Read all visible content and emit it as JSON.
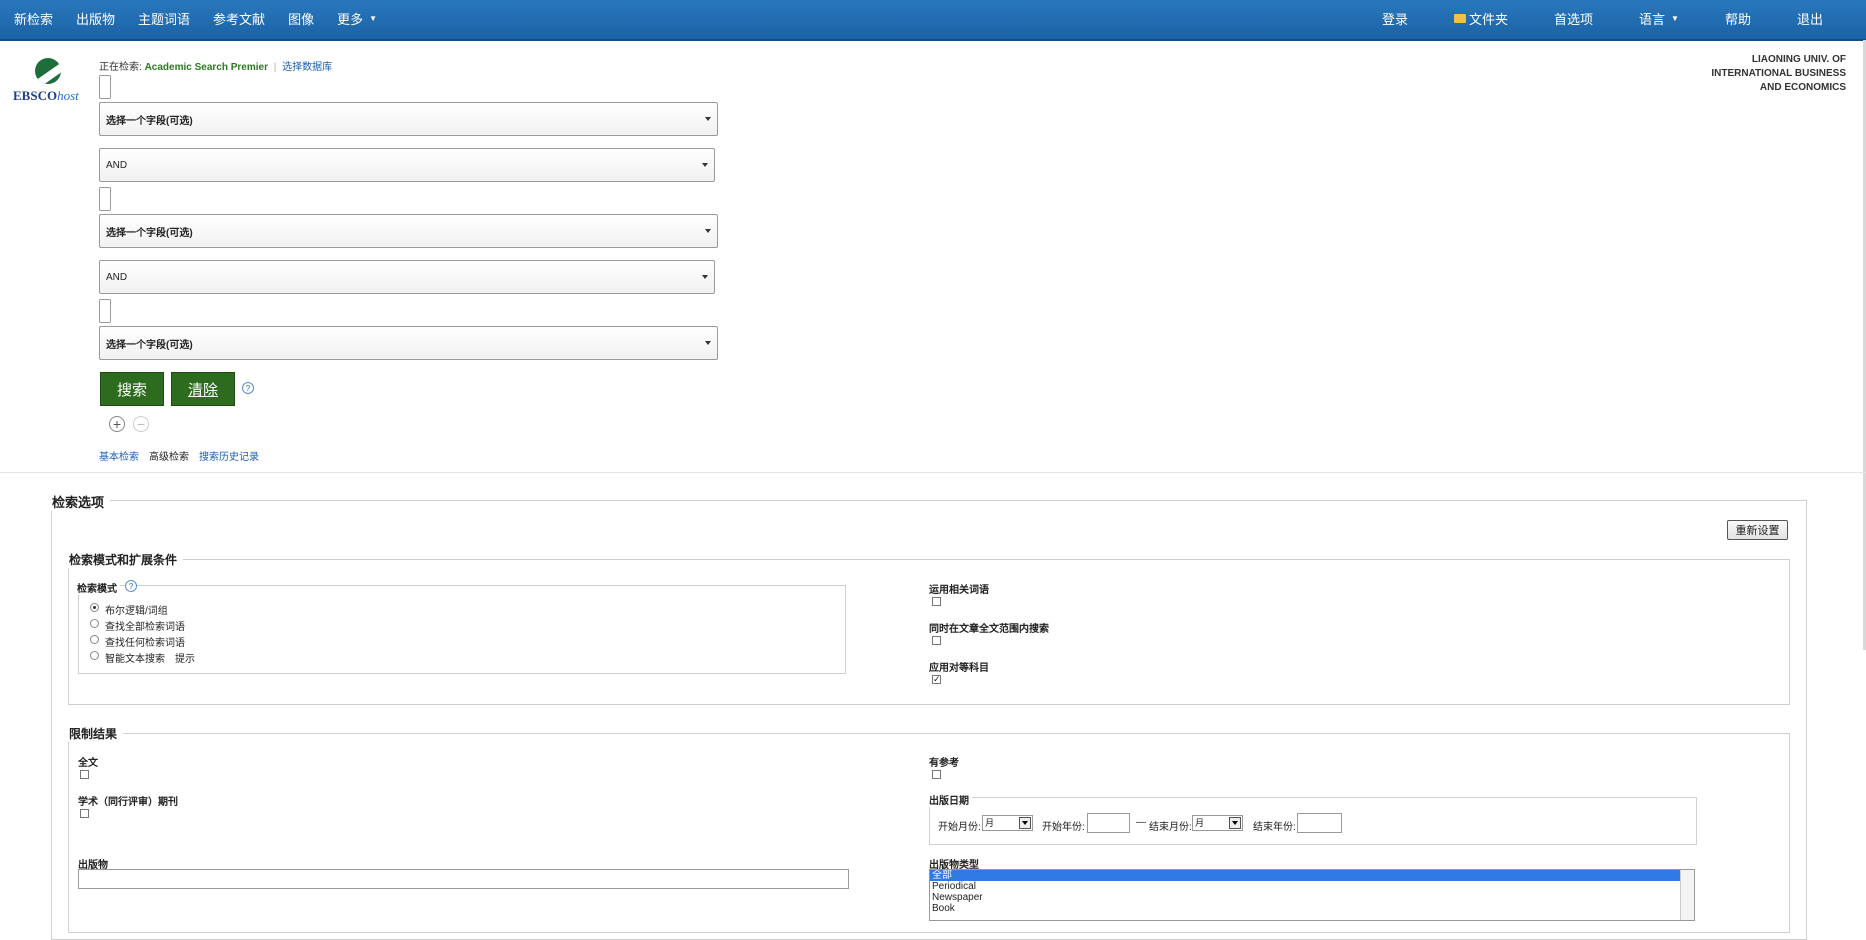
{
  "nav": {
    "left": [
      "新检索",
      "出版物",
      "主题词语",
      "参考文献",
      "图像",
      "更多"
    ],
    "right": [
      "登录",
      "文件夹",
      "首选项",
      "语言",
      "帮助",
      "退出"
    ]
  },
  "logo": {
    "brand": "EBSCO",
    "suffix": "host"
  },
  "header": {
    "searching_label": "正在检索:",
    "database": "Academic Search Premier",
    "separator": "|",
    "choose_db": "选择数据库"
  },
  "institution": [
    "LIAONING UNIV. OF",
    "INTERNATIONAL BUSINESS",
    "AND ECONOMICS"
  ],
  "search": {
    "field_placeholder": "选择一个字段(可选)",
    "bool1": "AND",
    "bool2": "AND",
    "search_btn": "搜索",
    "clear_btn": "清除",
    "help": "?",
    "plus": "+",
    "minus": "−"
  },
  "links": {
    "basic": "基本检索",
    "advanced": "高级检索",
    "history": "搜索历史记录"
  },
  "options": {
    "title": "检索选项",
    "reset": "重新设置",
    "modes": {
      "title": "检索模式和扩展条件",
      "mode_label": "检索模式",
      "help": "?",
      "radios": [
        "布尔逻辑/词组",
        "查找全部检索词语",
        "查找任何检索词语",
        "智能文本搜索"
      ],
      "hint": "提示",
      "related": "运用相关词语",
      "fulltext_search": "同时在文章全文范围内搜索",
      "equivalent": "应用对等科目",
      "equivalent_mark": "✓"
    },
    "limits": {
      "title": "限制结果",
      "fulltext": "全文",
      "scholarly": "学术（同行评审）期刊",
      "publication": "出版物",
      "references": "有参考",
      "pubdate": "出版日期",
      "start_month": "开始月份:",
      "start_year": "开始年份:",
      "dash": "—",
      "end_month": "结束月份:",
      "end_year": "结束年份:",
      "month": "月",
      "pubtype": "出版物类型",
      "pubtypes": [
        "全部",
        "Periodical",
        "Newspaper",
        "Book"
      ]
    }
  }
}
